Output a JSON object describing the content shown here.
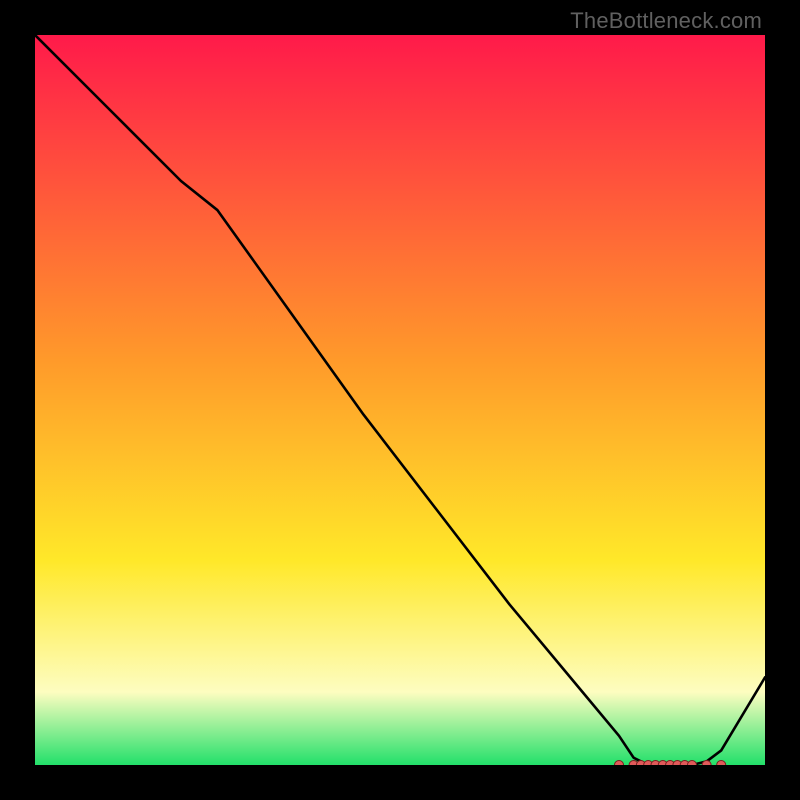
{
  "watermark": "TheBottleneck.com",
  "colors": {
    "frame": "#000000",
    "grad_top": "#ff1a4a",
    "grad_orange": "#ff9b2a",
    "grad_yellow": "#ffe829",
    "grad_pale": "#fdfdc0",
    "grad_green": "#22e06a",
    "line": "#000000",
    "marker_fill": "#e05a5a",
    "marker_stroke": "#7a1f1f"
  },
  "chart_data": {
    "type": "line",
    "title": "",
    "xlabel": "",
    "ylabel": "",
    "xlim": [
      0,
      100
    ],
    "ylim": [
      0,
      100
    ],
    "series": [
      {
        "name": "curve",
        "x": [
          0,
          10,
          20,
          25,
          35,
          45,
          55,
          65,
          75,
          80,
          82,
          84,
          86,
          88,
          90,
          92,
          94,
          100
        ],
        "y": [
          100,
          90,
          80,
          76,
          62,
          48,
          35,
          22,
          10,
          4,
          1,
          0,
          0,
          0,
          0,
          0.5,
          2,
          12
        ]
      }
    ],
    "markers": {
      "name": "segment-markers",
      "x": [
        80,
        82,
        83,
        84,
        85,
        86,
        87,
        88,
        89,
        90,
        92,
        94
      ],
      "y": [
        0,
        0,
        0,
        0,
        0,
        0,
        0,
        0,
        0,
        0,
        0,
        0
      ]
    }
  }
}
